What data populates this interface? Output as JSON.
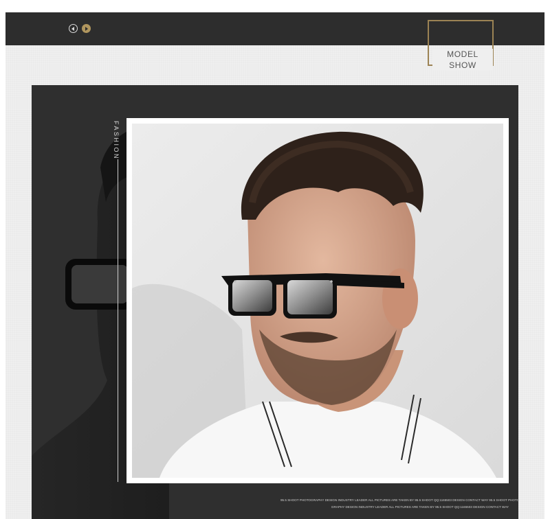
{
  "header": {
    "prev_label": "previous",
    "next_label": "next",
    "section_title": "MODEL SHOW"
  },
  "side_label": "FASHION",
  "photo": {
    "alt": "Man wearing black square sunglasses with silver mirrored lenses and a white polo shirt"
  },
  "credits": {
    "line1": "95.5 SHOOT PHOTOGRAPHY DESIGN INDUSTRY LEADER ALL PICTURES ARE TAKEN BY 95.5 SHOOT QQ:1165503 DESIGN CONTACT WAY 95.5 SHOOT PHOTO",
    "line2": "GRAPHY DESIGN INDUSTRY LEADER ALL PICTURES ARE TAKEN BY 95.5 SHOOT QQ:1165503 DESIGN CONTACT WAY"
  },
  "colors": {
    "top_bar": "#2d2d2d",
    "accent_gold": "#b0965e",
    "dark_panel": "#2f2f2f",
    "page_background": "#efefef"
  }
}
